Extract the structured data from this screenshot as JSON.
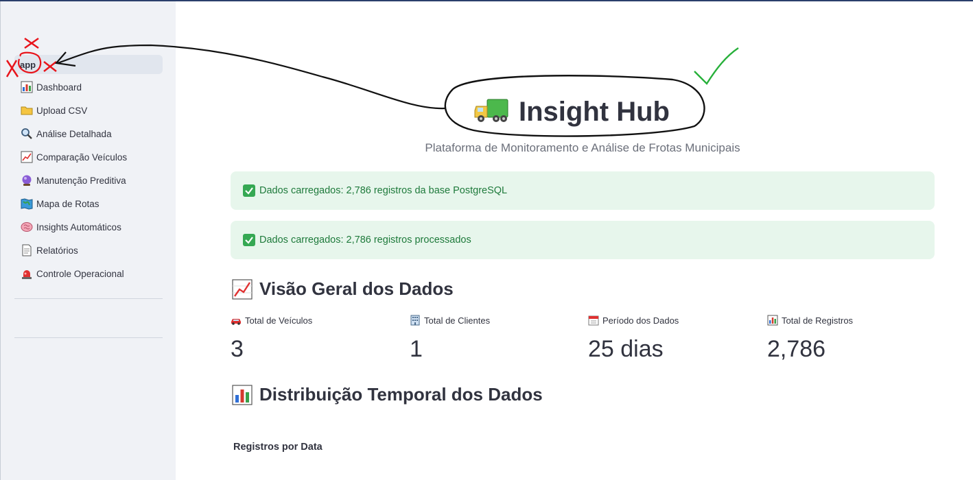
{
  "sidebar": {
    "items": [
      {
        "label": "app",
        "icon": "none",
        "active": true
      },
      {
        "label": "Dashboard",
        "icon": "bar-chart-icon"
      },
      {
        "label": "Upload CSV",
        "icon": "folder-icon"
      },
      {
        "label": "Análise Detalhada",
        "icon": "magnifier-icon"
      },
      {
        "label": "Comparação Veículos",
        "icon": "line-chart-icon"
      },
      {
        "label": "Manutenção Preditiva",
        "icon": "crystal-ball-icon"
      },
      {
        "label": "Mapa de Rotas",
        "icon": "map-icon"
      },
      {
        "label": "Insights Automáticos",
        "icon": "brain-icon"
      },
      {
        "label": "Relatórios",
        "icon": "document-icon"
      },
      {
        "label": "Controle Operacional",
        "icon": "siren-icon"
      }
    ]
  },
  "main": {
    "title": "Insight Hub",
    "title_icon": "truck-icon",
    "subtitle": "Plataforma de Monitoramento e Análise de Frotas Municipais",
    "alerts": [
      "Dados carregados: 2,786 registros da base PostgreSQL",
      "Dados carregados: 2,786 registros processados"
    ],
    "overview": {
      "heading": "Visão Geral dos Dados",
      "metrics": [
        {
          "label": "Total de Veículos",
          "value": "3",
          "icon": "car-icon"
        },
        {
          "label": "Total de Clientes",
          "value": "1",
          "icon": "building-icon"
        },
        {
          "label": "Período dos Dados",
          "value": "25 dias",
          "icon": "calendar-icon"
        },
        {
          "label": "Total de Registros",
          "value": "2,786",
          "icon": "bar-chart-icon"
        }
      ]
    },
    "distribution": {
      "heading": "Distribuição Temporal dos Dados",
      "chart_label": "Registros por Data"
    }
  },
  "colors": {
    "sidebar_bg": "#f0f2f6",
    "alert_bg": "#e7f6ec",
    "alert_text": "#1e7a3b",
    "annotation_red": "#e8141b",
    "annotation_green": "#27b03a"
  }
}
